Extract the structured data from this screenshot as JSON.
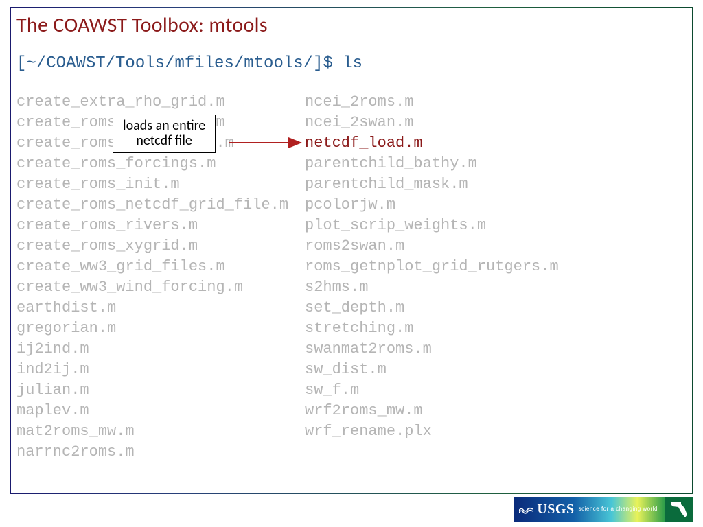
{
  "title": "The COAWST Toolbox: mtools",
  "prompt": "[~/COAWST/Tools/mfiles/mtools/]$ ls",
  "callout": {
    "line1": "loads an entire",
    "line2": "netcdf file"
  },
  "highlight_file": "netcdf_load.m",
  "columns": {
    "left": [
      "create_extra_rho_grid.m",
      "create_roms_child_clm.m",
      "create_roms_child_init.m",
      "create_roms_forcings.m",
      "create_roms_init.m",
      "create_roms_netcdf_grid_file.m",
      "create_roms_rivers.m",
      "create_roms_xygrid.m",
      "create_ww3_grid_files.m",
      "create_ww3_wind_forcing.m",
      "earthdist.m",
      "gregorian.m",
      "ij2ind.m",
      "ind2ij.m",
      "julian.m",
      "maplev.m",
      "mat2roms_mw.m",
      "narrnc2roms.m"
    ],
    "right": [
      "ncei_2roms.m",
      "ncei_2swan.m",
      "netcdf_load.m",
      "parentchild_bathy.m",
      "parentchild_mask.m",
      "pcolorjw.m",
      "plot_scrip_weights.m",
      "roms2swan.m",
      "roms_getnplot_grid_rutgers.m",
      "s2hms.m",
      "set_depth.m",
      "stretching.m",
      "swanmat2roms.m",
      "sw_dist.m",
      "sw_f.m",
      "wrf2roms_mw.m",
      "wrf_rename.plx"
    ]
  },
  "footer": {
    "org": "USGS",
    "tagline": "science for a changing world"
  }
}
